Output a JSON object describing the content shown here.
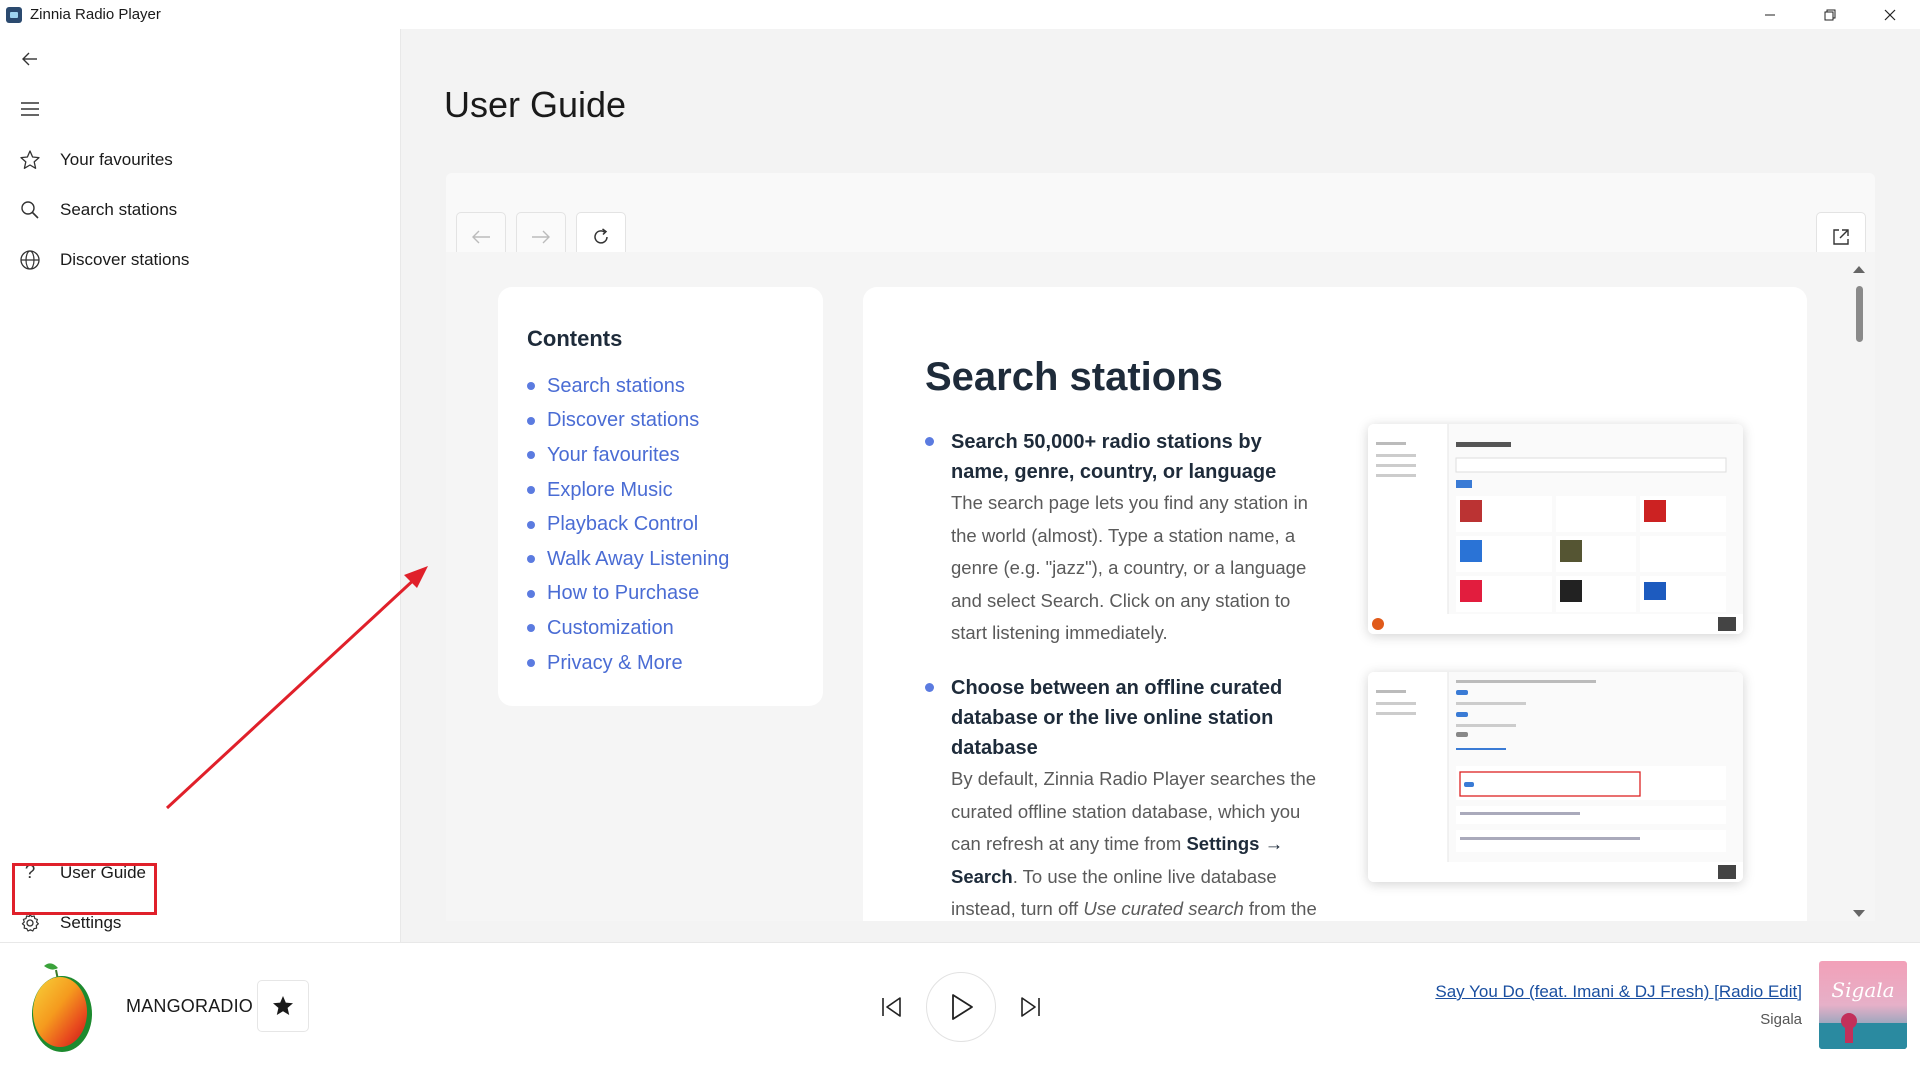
{
  "window": {
    "title": "Zinnia Radio Player",
    "controls": {
      "minimize": "—",
      "maximize": "❐",
      "close": "✕"
    }
  },
  "sidebar": {
    "top_items": [
      {
        "label": "Your favourites",
        "icon": "star-icon"
      },
      {
        "label": "Search stations",
        "icon": "search-icon"
      },
      {
        "label": "Discover stations",
        "icon": "globe-icon"
      }
    ],
    "bottom_items": [
      {
        "label": "User Guide",
        "icon": "help-icon"
      },
      {
        "label": "Settings",
        "icon": "gear-icon"
      }
    ],
    "user_guide_glyph": "?"
  },
  "main": {
    "page_title": "User Guide",
    "contents": {
      "title": "Contents",
      "items": [
        "Search stations",
        "Discover stations",
        "Your favourites",
        "Explore Music",
        "Playback Control",
        "Walk Away Listening",
        "How to Purchase",
        "Customization",
        "Privacy & More"
      ]
    },
    "article": {
      "heading": "Search stations",
      "features": [
        {
          "title": "Search 50,000+ radio stations by name, genre, country, or language",
          "body": "The search page lets you find any station in the world (almost). Type a station name, a genre (e.g. \"jazz\"), a country, or a language and select Search. Click on any station to start listening immediately."
        },
        {
          "title": "Choose between an offline curated database or the live online station database",
          "body_1": "By default, Zinnia Radio Player searches the curated offline station database, which you can refresh at any time from ",
          "body_bold_1": "Settings → Search",
          "body_2": ". To use the online live database instead, turn off ",
          "body_italic": "Use curated search",
          "body_3": " from the"
        }
      ]
    }
  },
  "player": {
    "station": "MANGORADIO",
    "song_title": "Say You Do (feat. Imani & DJ Fresh) [Radio Edit]",
    "artist": "Sigala",
    "album_art_text": "Sigala"
  },
  "colors": {
    "accent": "#4a6cd4",
    "annotation": "#e0202a",
    "link": "#1a4fa0"
  }
}
